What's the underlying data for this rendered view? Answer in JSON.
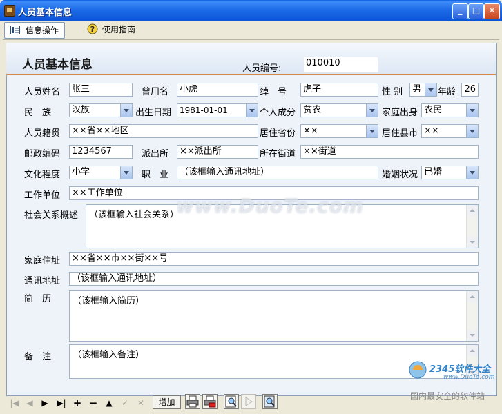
{
  "window": {
    "title": "人员基本信息"
  },
  "tabs": [
    {
      "label": "信息操作"
    },
    {
      "label": "使用指南"
    }
  ],
  "form": {
    "title": "人员基本信息",
    "id_label": "人员编号:",
    "id_value": "010010",
    "name_label": "人员姓名",
    "name_value": "张三",
    "former_name_label": "曾用名",
    "former_name_value": "小虎",
    "nickname_label": "绰　号",
    "nickname_value": "虎子",
    "gender_label": "性 别",
    "gender_value": "男",
    "age_label": "年龄",
    "age_value": "26",
    "ethnicity_label": "民　族",
    "ethnicity_value": "汉族",
    "birthdate_label": "出生日期",
    "birthdate_value": "1981-01-01",
    "class_label": "个人成分",
    "class_value": "贫农",
    "family_label": "家庭出身",
    "family_value": "农民",
    "origin_label": "人员籍贯",
    "origin_value": "××省××地区",
    "province_label": "居住省份",
    "province_value": "××",
    "county_label": "居住县市",
    "county_value": "××",
    "postcode_label": "邮政编码",
    "postcode_value": "1234567",
    "police_label": "派出所",
    "police_value": "××派出所",
    "street_label": "所在街道",
    "street_value": "××街道",
    "education_label": "文化程度",
    "education_value": "小学",
    "occupation_label": "职　业",
    "occupation_value": "（该框输入通讯地址）",
    "marital_label": "婚姻状况",
    "marital_value": "已婚",
    "workplace_label": "工作单位",
    "workplace_value": "××工作单位",
    "social_label": "社会关系概述",
    "social_value": "（该框输入社会关系）",
    "home_label": "家庭住址",
    "home_value": "××省××市××街××号",
    "mail_label": "通讯地址",
    "mail_value": "（该框输入通讯地址）",
    "resume_label": "简　历",
    "resume_value": "（该框输入简历）",
    "notes_label": "备　注",
    "notes_value": "（该框输入备注）"
  },
  "toolbar": {
    "nav_first": "|◀",
    "nav_prev": "◀",
    "nav_next": "▶",
    "nav_last": "▶|",
    "nav_add": "+",
    "nav_delete": "−",
    "nav_edit": "▲",
    "nav_post": "✓",
    "nav_cancel": "✕",
    "add_label": "增加"
  },
  "overlay": {
    "watermark": "www.DuoTe.com",
    "brand_name": "2345软件大全",
    "brand_url": "www.DuoTe.com",
    "brand_slogan": "国内最安全的软件站"
  },
  "colors": {
    "titlebar": "#1E6CE8",
    "accent_underline": "#D88A4A",
    "panel_bg": "#EEF3FA"
  }
}
